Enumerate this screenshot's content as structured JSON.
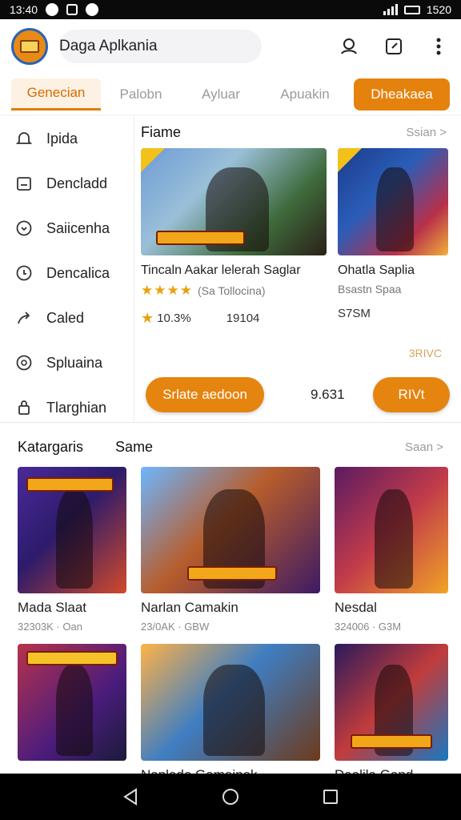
{
  "status": {
    "time": "13:40",
    "right_time": "1520"
  },
  "app": {
    "title": "Daga Aplkania"
  },
  "tabs": [
    {
      "label": "Genecian"
    },
    {
      "label": "Palobn"
    },
    {
      "label": "Ayluar"
    },
    {
      "label": "Apuakin"
    },
    {
      "label": "Dheakaea"
    }
  ],
  "sidebar": {
    "items": [
      {
        "label": "Ipida",
        "icon": "bell-icon"
      },
      {
        "label": "Dencladd",
        "icon": "download-icon"
      },
      {
        "label": "Saiicenha",
        "icon": "chevron-circle-icon"
      },
      {
        "label": "Dencalica",
        "icon": "clock-icon"
      },
      {
        "label": "Caled",
        "icon": "share-icon"
      },
      {
        "label": "Spluaina",
        "icon": "chat-icon"
      },
      {
        "label": "Tlarghian",
        "icon": "lock-icon"
      }
    ]
  },
  "featured": {
    "title": "Fiame",
    "see": "Ssian >",
    "cards": [
      {
        "name": "Tincaln Aakar lelerah Saglar",
        "rating_text": "(Sa Tollocina)",
        "meta1": "10.3%",
        "meta2": "19104"
      },
      {
        "name": "Ohatla Saplia",
        "sub": "Bsastn Spaa",
        "meta1": "S7SM"
      }
    ],
    "side_note": "3RIVC",
    "button": "Srlate aedoon",
    "count": "9.631",
    "button2": "RIVt"
  },
  "categories": {
    "title": "Katargaris",
    "title2": "Same",
    "see": "Saan >",
    "items": [
      {
        "name": "Mada Slaat",
        "sub": "32303K · Oan"
      },
      {
        "name": "Narlan Camakin",
        "sub": "23/0AK · GBW"
      },
      {
        "name": "Nesdal",
        "sub": "324006 · G3M"
      },
      {
        "name": "",
        "sub": ""
      },
      {
        "name": "Nanlado Gamainek",
        "sub": ""
      },
      {
        "name": "Daalila Gand",
        "sub": ""
      }
    ]
  },
  "colors": {
    "accent": "#e5840f",
    "tab_active": "#d66c00"
  }
}
